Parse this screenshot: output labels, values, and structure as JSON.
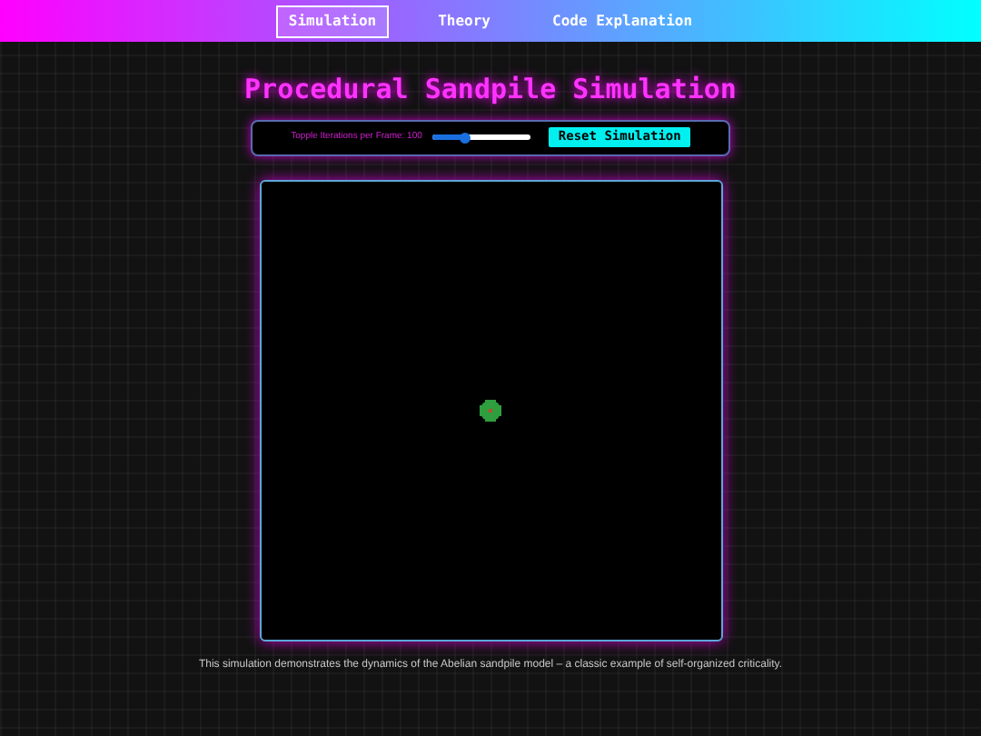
{
  "nav": {
    "items": [
      {
        "label": "Simulation",
        "selected": true
      },
      {
        "label": "Theory",
        "selected": false
      },
      {
        "label": "Code Explanation",
        "selected": false
      }
    ]
  },
  "title": "Procedural Sandpile Simulation",
  "controls": {
    "slider_label": "Topple Iterations per Frame: 100",
    "slider": {
      "level": 0.33
    },
    "reset_button": "Reset Simulation"
  },
  "description": "This simulation demonstrates the dynamics of the Abelian sandpile model – a classic example of self-organized criticality."
}
